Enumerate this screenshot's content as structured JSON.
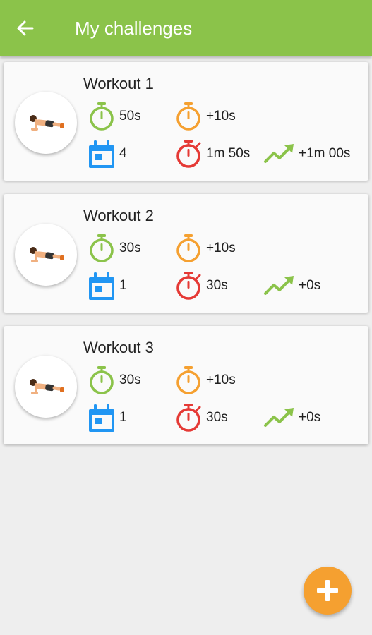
{
  "appbar": {
    "title": "My challenges"
  },
  "colors": {
    "appbar": "#8bc34a",
    "green": "#8bc34a",
    "orange": "#f5a030",
    "red": "#e53935",
    "blue": "#2196f3",
    "fab": "#f5a030"
  },
  "workouts": [
    {
      "name": "Workout 1",
      "duration": "50s",
      "increment": "+10s",
      "days": "4",
      "current": "1m 50s",
      "progress": "+1m 00s"
    },
    {
      "name": "Workout 2",
      "duration": "30s",
      "increment": "+10s",
      "days": "1",
      "current": "30s",
      "progress": "+0s"
    },
    {
      "name": "Workout 3",
      "duration": "30s",
      "increment": "+10s",
      "days": "1",
      "current": "30s",
      "progress": "+0s"
    }
  ],
  "icons": {
    "back": "arrow-left-icon",
    "exercise": "plank-exercise-icon",
    "duration": "stopwatch-green-icon",
    "increment": "stopwatch-orange-icon",
    "days": "calendar-icon",
    "current": "stopwatch-red-icon",
    "progress": "trending-up-icon",
    "add": "plus-icon"
  }
}
